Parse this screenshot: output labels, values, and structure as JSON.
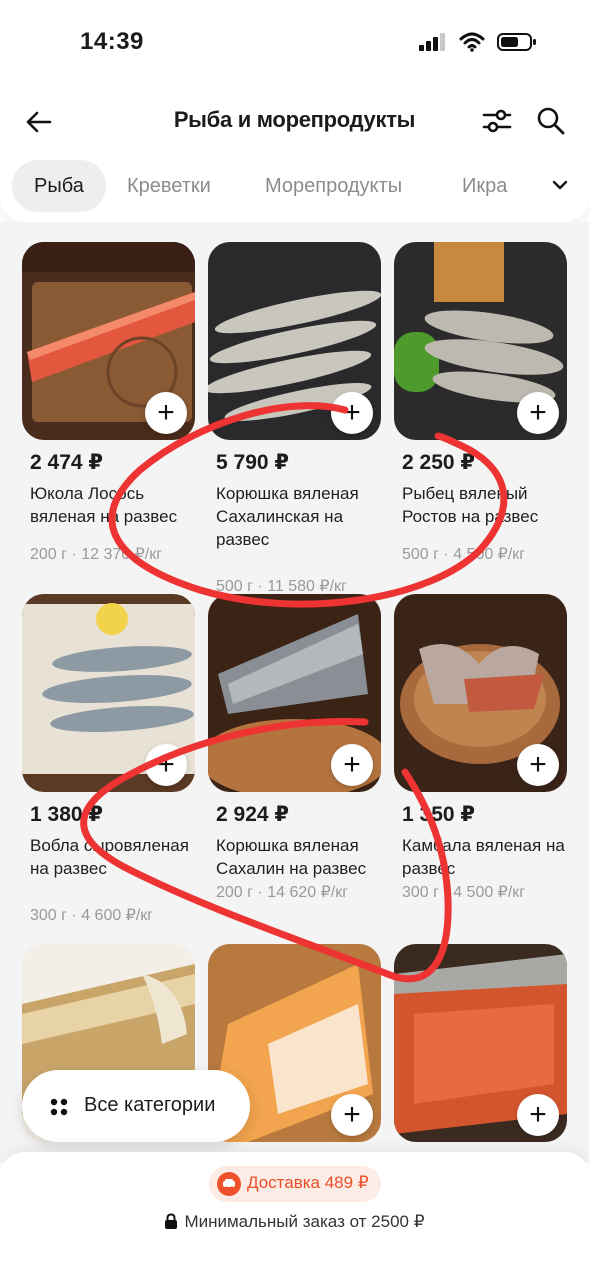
{
  "status_bar": {
    "time": "14:39"
  },
  "header": {
    "title": "Рыба и морепродукты"
  },
  "tabs": [
    "Рыба",
    "Креветки",
    "Морепродукты",
    "Икра"
  ],
  "products": [
    {
      "price": "2 474 ₽",
      "name": "Юкола Лосось вяленая на развес",
      "weight": "200 г · 12 370 ₽/кг"
    },
    {
      "price": "5 790 ₽",
      "name": "Корюшка вяленая Сахалинская на развес",
      "weight": "500 г · 11 580 ₽/кг"
    },
    {
      "price": "2 250 ₽",
      "name": "Рыбец вяленый Ростов на развес",
      "weight": "500 г · 4 500 ₽/кг"
    },
    {
      "price": "1 380 ₽",
      "name": "Вобла сыровяленая на развес",
      "weight": "300 г · 4 600 ₽/кг"
    },
    {
      "price": "2 924 ₽",
      "name": "Корюшка вяленая Сахалин на развес",
      "weight": "200 г · 14 620 ₽/кг"
    },
    {
      "price": "1 350 ₽",
      "name": "Камбала вяленая на развес",
      "weight": "300 г · 4 500 ₽/кг"
    }
  ],
  "all_categories_label": "Все категории",
  "delivery_label": "Доставка 489 ₽",
  "min_order_label": "Минимальный заказ от 2500 ₽",
  "add_glyph": "+",
  "colors": {
    "accent": "#f0502a",
    "annotation": "#ee3333",
    "background": "#f4f4f4"
  }
}
